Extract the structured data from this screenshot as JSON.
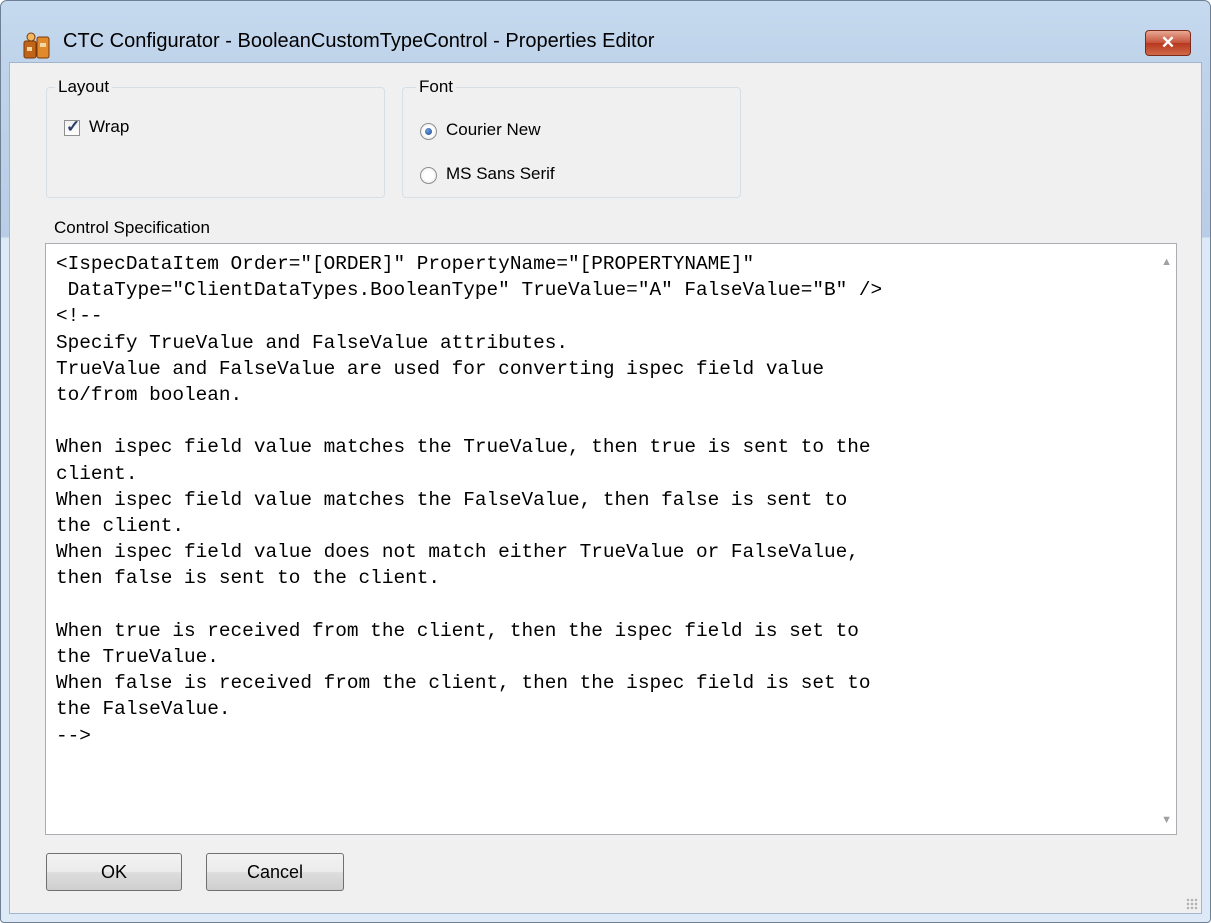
{
  "window": {
    "title": "CTC Configurator - BooleanCustomTypeControl - Properties Editor",
    "close_glyph": "✕"
  },
  "layout_group": {
    "label": "Layout",
    "wrap": {
      "label": "Wrap",
      "checked": true
    }
  },
  "font_group": {
    "label": "Font",
    "options": [
      {
        "label": "Courier New",
        "selected": true
      },
      {
        "label": "MS Sans Serif",
        "selected": false
      }
    ]
  },
  "spec": {
    "label": "Control Specification",
    "text": "<IspecDataItem Order=\"[ORDER]\" PropertyName=\"[PROPERTYNAME]\"\n DataType=\"ClientDataTypes.BooleanType\" TrueValue=\"A\" FalseValue=\"B\" />\n<!--\nSpecify TrueValue and FalseValue attributes.\nTrueValue and FalseValue are used for converting ispec field value\nto/from boolean.\n\nWhen ispec field value matches the TrueValue, then true is sent to the\nclient.\nWhen ispec field value matches the FalseValue, then false is sent to\nthe client.\nWhen ispec field value does not match either TrueValue or FalseValue,\nthen false is sent to the client.\n\nWhen true is received from the client, then the ispec field is set to\nthe TrueValue.\nWhen false is received from the client, then the ispec field is set to\nthe FalseValue.\n-->"
  },
  "buttons": {
    "ok": "OK",
    "cancel": "Cancel"
  },
  "colors": {
    "titlebar": "#c5d9ef",
    "client_bg": "#f0f0f0",
    "close_button": "#c6523a"
  }
}
